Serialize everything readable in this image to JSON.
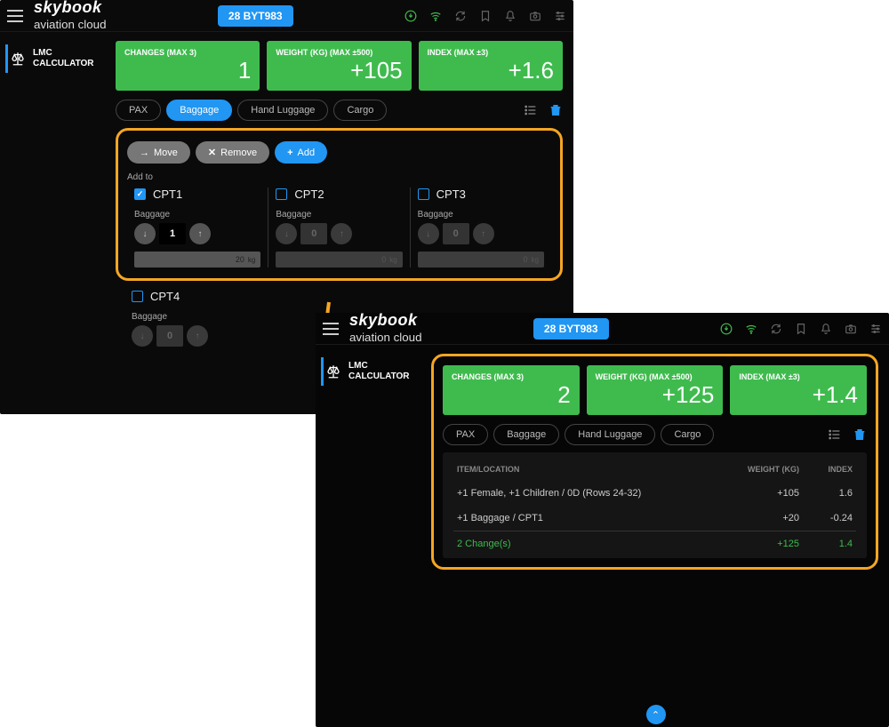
{
  "common": {
    "logo": "skybook",
    "logo_sub": "aviation cloud",
    "sidebar": {
      "label": "LMC\nCALCULATOR"
    }
  },
  "app1": {
    "flight": "28 BYT983",
    "metrics": [
      {
        "label": "CHANGES (MAX 3)",
        "value": "1"
      },
      {
        "label": "WEIGHT (KG) (MAX ±500)",
        "value": "+105"
      },
      {
        "label": "INDEX (MAX ±3)",
        "value": "+1.6"
      }
    ],
    "tabs": {
      "pax": "PAX",
      "baggage": "Baggage",
      "hand": "Hand Luggage",
      "cargo": "Cargo"
    },
    "actions": {
      "move": "Move",
      "remove": "Remove",
      "add": "Add"
    },
    "addto": "Add to",
    "cpts": [
      {
        "name": "CPT1",
        "checked": true,
        "sub": "Baggage",
        "val": "1",
        "wt": "20",
        "unit": "kg",
        "enabled": true
      },
      {
        "name": "CPT2",
        "checked": false,
        "sub": "Baggage",
        "val": "0",
        "wt": "0",
        "unit": "kg",
        "enabled": false
      },
      {
        "name": "CPT3",
        "checked": false,
        "sub": "Baggage",
        "val": "0",
        "wt": "0",
        "unit": "kg",
        "enabled": false
      }
    ],
    "cpt4": {
      "name": "CPT4",
      "checked": false,
      "sub": "Baggage",
      "val": "0"
    }
  },
  "app2": {
    "flight": "28 BYT983",
    "metrics": [
      {
        "label": "CHANGES (MAX 3)",
        "value": "2"
      },
      {
        "label": "WEIGHT (KG) (MAX ±500)",
        "value": "+125"
      },
      {
        "label": "INDEX (MAX ±3)",
        "value": "+1.4"
      }
    ],
    "tabs": {
      "pax": "PAX",
      "baggage": "Baggage",
      "hand": "Hand Luggage",
      "cargo": "Cargo"
    },
    "table": {
      "headers": {
        "item": "ITEM/LOCATION",
        "weight": "WEIGHT (KG)",
        "index": "INDEX"
      },
      "rows": [
        {
          "item": "+1 Female, +1 Children / 0D (Rows 24-32)",
          "weight": "+105",
          "index": "1.6"
        },
        {
          "item": "+1 Baggage / CPT1",
          "weight": "+20",
          "index": "-0.24"
        }
      ],
      "total": {
        "item": "2 Change(s)",
        "weight": "+125",
        "index": "1.4"
      }
    }
  }
}
